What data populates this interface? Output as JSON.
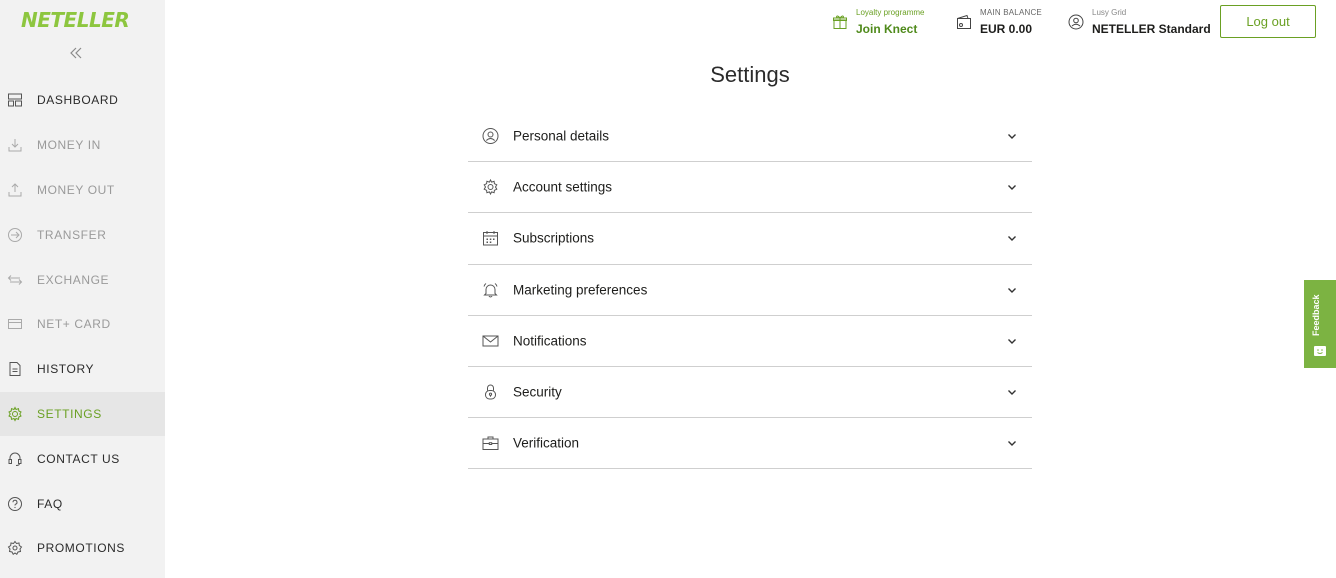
{
  "brand": {
    "logo_text": "NETELLER",
    "accent": "#6aa023",
    "logo_color": "#8dc63f"
  },
  "sidebar": {
    "collapse_icon": "double-chevron-left-icon",
    "items": [
      {
        "label": "DASHBOARD",
        "icon": "dashboard-icon",
        "state": "dark"
      },
      {
        "label": "MONEY IN",
        "icon": "download-tray-icon",
        "state": "muted"
      },
      {
        "label": "MONEY OUT",
        "icon": "upload-tray-icon",
        "state": "muted"
      },
      {
        "label": "TRANSFER",
        "icon": "arrow-circle-icon",
        "state": "muted"
      },
      {
        "label": "EXCHANGE",
        "icon": "swap-arrows-icon",
        "state": "muted"
      },
      {
        "label": "NET+ CARD",
        "icon": "card-icon",
        "state": "muted"
      },
      {
        "label": "HISTORY",
        "icon": "document-icon",
        "state": "dark"
      },
      {
        "label": "SETTINGS",
        "icon": "gear-icon",
        "state": "active"
      },
      {
        "label": "CONTACT US",
        "icon": "headset-icon",
        "state": "dark"
      },
      {
        "label": "FAQ",
        "icon": "question-icon",
        "state": "dark"
      },
      {
        "label": "PROMOTIONS",
        "icon": "badge-icon",
        "state": "dark"
      }
    ]
  },
  "header": {
    "loyalty": {
      "small": "Loyalty programme",
      "main": "Join Knect",
      "icon": "gift-icon",
      "color": "#6aa023"
    },
    "balance": {
      "small": "MAIN BALANCE",
      "main": "EUR 0.00",
      "icon": "wallet-icon"
    },
    "user": {
      "small": "Lusy Grid",
      "main": "NETELLER Standard",
      "icon": "user-circle-icon"
    },
    "logout_label": "Log out"
  },
  "main": {
    "title": "Settings",
    "sections": [
      {
        "label": "Personal details",
        "icon": "user-circle-icon"
      },
      {
        "label": "Account settings",
        "icon": "gear-icon"
      },
      {
        "label": "Subscriptions",
        "icon": "calendar-icon"
      },
      {
        "label": "Marketing preferences",
        "icon": "bell-icon"
      },
      {
        "label": "Notifications",
        "icon": "envelope-icon"
      },
      {
        "label": "Security",
        "icon": "lock-icon"
      },
      {
        "label": "Verification",
        "icon": "briefcase-icon"
      }
    ]
  },
  "feedback": {
    "label": "Feedback",
    "color": "#7cb342"
  }
}
